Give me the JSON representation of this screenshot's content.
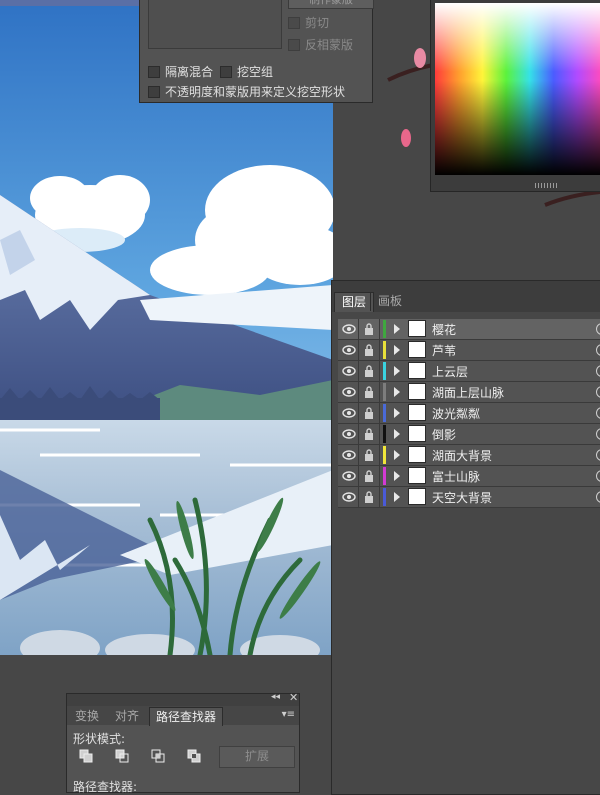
{
  "transparency_panel": {
    "make_mask_button": "制作蒙版",
    "clip_label": "剪切",
    "invert_mask_label": "反相蒙版",
    "isolate_blending_label": "隔离混合",
    "knockout_group_label": "挖空组",
    "opacity_mask_define_knockout_label": "不透明度和蒙版用来定义挖空形状"
  },
  "layers_panel": {
    "tabs": [
      "图层",
      "画板"
    ],
    "layers": [
      {
        "name": "樱花",
        "color": "#3fa83f",
        "selected": true
      },
      {
        "name": "芦苇",
        "color": "#e8e03a",
        "selected": false
      },
      {
        "name": "上云层",
        "color": "#3ad3e0",
        "selected": false
      },
      {
        "name": "湖面上层山脉",
        "color": "#7d7d7d",
        "selected": false
      },
      {
        "name": "波光粼粼",
        "color": "#4a6ad8",
        "selected": false
      },
      {
        "name": "倒影",
        "color": "#111111",
        "selected": false
      },
      {
        "name": "湖面大背景",
        "color": "#f0e63a",
        "selected": false
      },
      {
        "name": "富士山脉",
        "color": "#d33ad3",
        "selected": false
      },
      {
        "name": "天空大背景",
        "color": "#4a5ad8",
        "selected": false
      }
    ]
  },
  "pathfinder_panel": {
    "tabs": [
      "变换",
      "对齐",
      "路径查找器"
    ],
    "shape_modes_label": "形状模式:",
    "expand_button": "扩展",
    "pathfinders_label": "路径查找器:"
  },
  "colors": {
    "panel_bg": "#535353",
    "sky_top": "#2f7fcf",
    "lake": "#a8c6de"
  }
}
